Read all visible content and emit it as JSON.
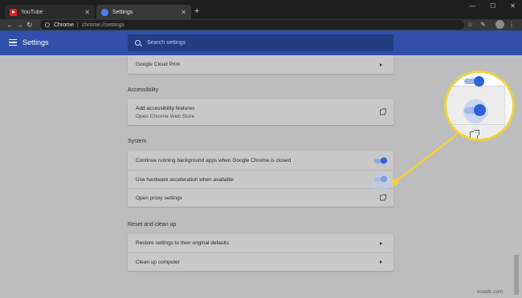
{
  "browser": {
    "tabs": [
      {
        "label": "YouTube",
        "icon": "youtube-icon",
        "active": false
      },
      {
        "label": "Settings",
        "icon": "settings-gear-icon",
        "active": true
      }
    ],
    "new_tab": "+",
    "window_controls": {
      "minimize": "—",
      "maximize": "☐",
      "close": "✕"
    },
    "omnibox": {
      "site_label": "Chrome",
      "separator": "|",
      "url": "chrome://settings"
    }
  },
  "settings_header": {
    "title": "Settings",
    "search_placeholder": "Search settings",
    "accent": "#2f4fa9"
  },
  "sections": {
    "printing": {
      "rows": [
        {
          "label": "Google Cloud Print",
          "control": "arrow"
        }
      ]
    },
    "accessibility": {
      "title": "Accessibility",
      "rows": [
        {
          "label": "Add accessibility features",
          "sublabel": "Open Chrome Web Store",
          "control": "external-link"
        }
      ]
    },
    "system": {
      "title": "System",
      "rows": [
        {
          "label": "Continue running background apps when Google Chrome is closed",
          "control": "toggle",
          "on": true
        },
        {
          "label": "Use hardware acceleration when available",
          "control": "toggle",
          "on": true
        },
        {
          "label": "Open proxy settings",
          "control": "external-link"
        }
      ]
    },
    "reset": {
      "title": "Reset and clean up",
      "rows": [
        {
          "label": "Restore settings to their original defaults",
          "control": "arrow"
        },
        {
          "label": "Clean up computer",
          "control": "arrow"
        }
      ]
    }
  },
  "callout_color": "#f3d23a",
  "watermark": "wsxdn.com"
}
